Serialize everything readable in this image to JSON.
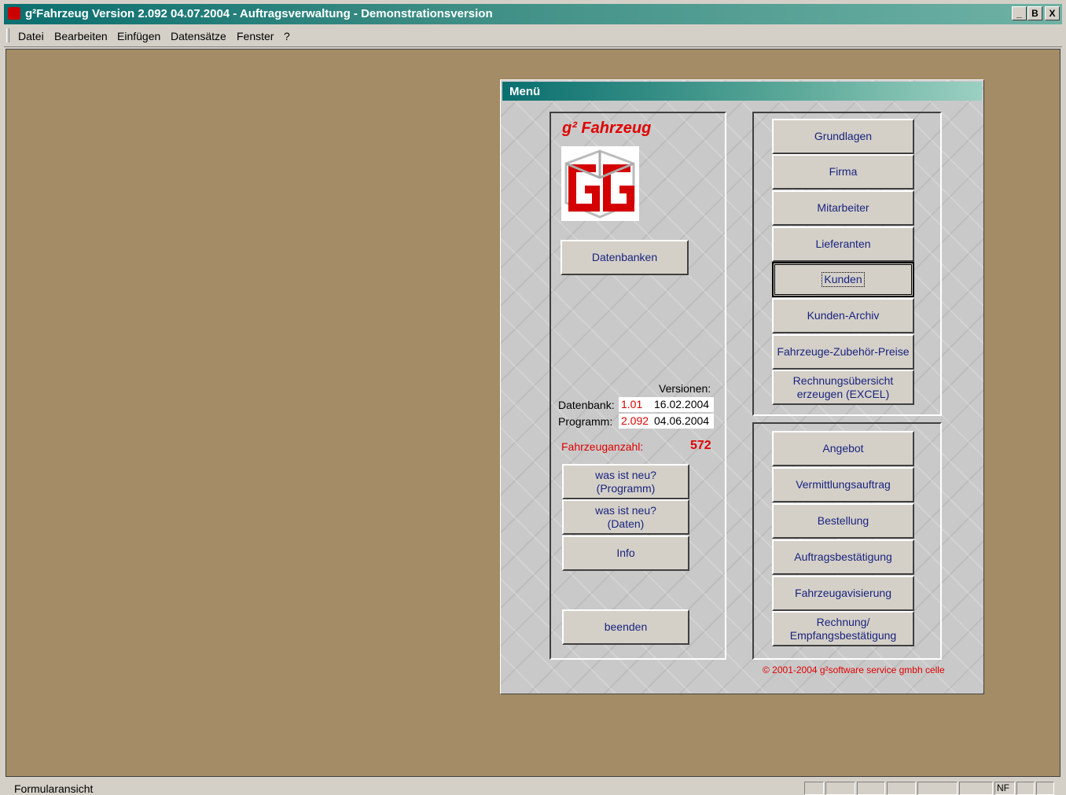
{
  "window": {
    "title": "g²Fahrzeug Version 2.092 04.07.2004  - Auftragsverwaltung - Demonstrationsversion",
    "icon": "app-icon",
    "controls": {
      "minimize": "_",
      "maximize": "B",
      "close": "X"
    }
  },
  "menubar": {
    "items": [
      "Datei",
      "Bearbeiten",
      "Einfügen",
      "Datensätze",
      "Fenster",
      "?"
    ]
  },
  "form": {
    "title": "Menü",
    "logo_title": "g² Fahrzeug",
    "datenbanken_button": "Datenbanken",
    "versions": {
      "heading": "Versionen:",
      "datenbank_label": "Datenbank:",
      "datenbank_version": "1.01",
      "datenbank_date": "16.02.2004",
      "programm_label": "Programm:",
      "programm_version": "2.092",
      "programm_date": "04.06.2004"
    },
    "vehicle_count_label": "Fahrzeuganzahl:",
    "vehicle_count": "572",
    "left_buttons": {
      "news_program_1": "was ist neu?",
      "news_program_2": "(Programm)",
      "news_data_1": "was ist neu?",
      "news_data_2": "(Daten)",
      "info": "Info",
      "quit": "beenden"
    },
    "top_buttons": [
      "Grundlagen",
      "Firma",
      "Mitarbeiter",
      "Lieferanten",
      "Kunden",
      "Kunden-Archiv",
      "Fahrzeuge-Zubehör-Preise"
    ],
    "excel_button_1": "Rechnungsübersicht",
    "excel_button_2": "erzeugen (EXCEL)",
    "bottom_buttons": [
      "Angebot",
      "Vermittlungsauftrag",
      "Bestellung",
      "Auftragsbestätigung",
      "Fahrzeugavisierung"
    ],
    "invoice_button_1": "Rechnung/",
    "invoice_button_2": "Empfangsbestätigung",
    "copyright": "© 2001-2004  g²software service gmbh celle"
  },
  "statusbar": {
    "text": "Formularansicht",
    "indicator": "NF"
  }
}
